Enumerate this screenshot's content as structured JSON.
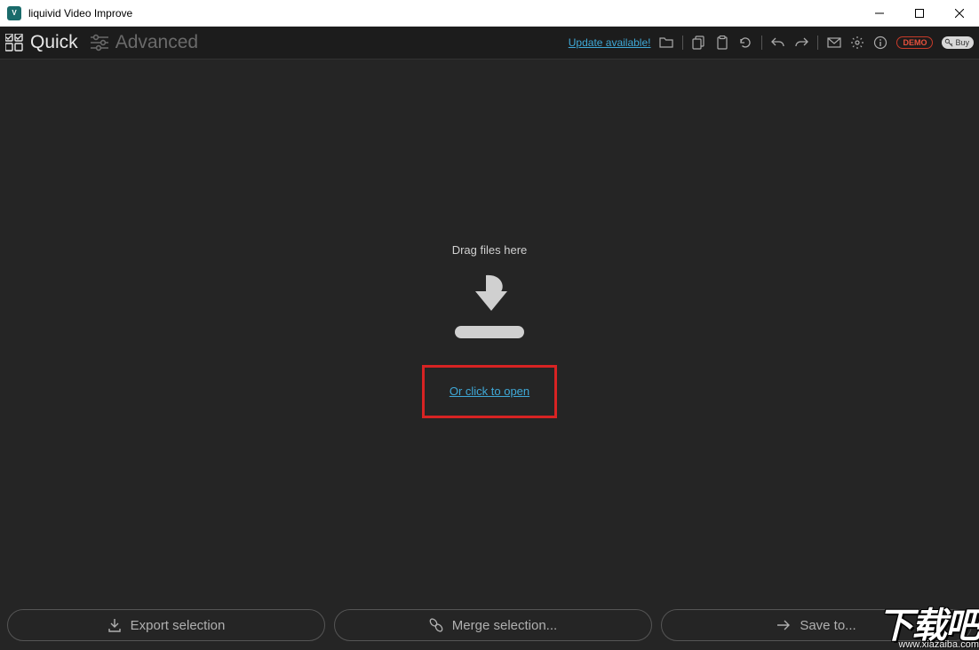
{
  "window": {
    "title": "liquivid Video Improve"
  },
  "toolbar": {
    "modes": {
      "quick": "Quick",
      "advanced": "Advanced"
    },
    "update_link": "Update available!",
    "demo_label": "DEMO",
    "buy_label": "Buy"
  },
  "drop": {
    "drag_label": "Drag files here",
    "open_link": "Or click to open"
  },
  "bottom": {
    "export": "Export selection",
    "merge": "Merge selection...",
    "save": "Save to..."
  },
  "watermark": {
    "cn": "下载吧",
    "url": "www.xiazaiba.com"
  }
}
